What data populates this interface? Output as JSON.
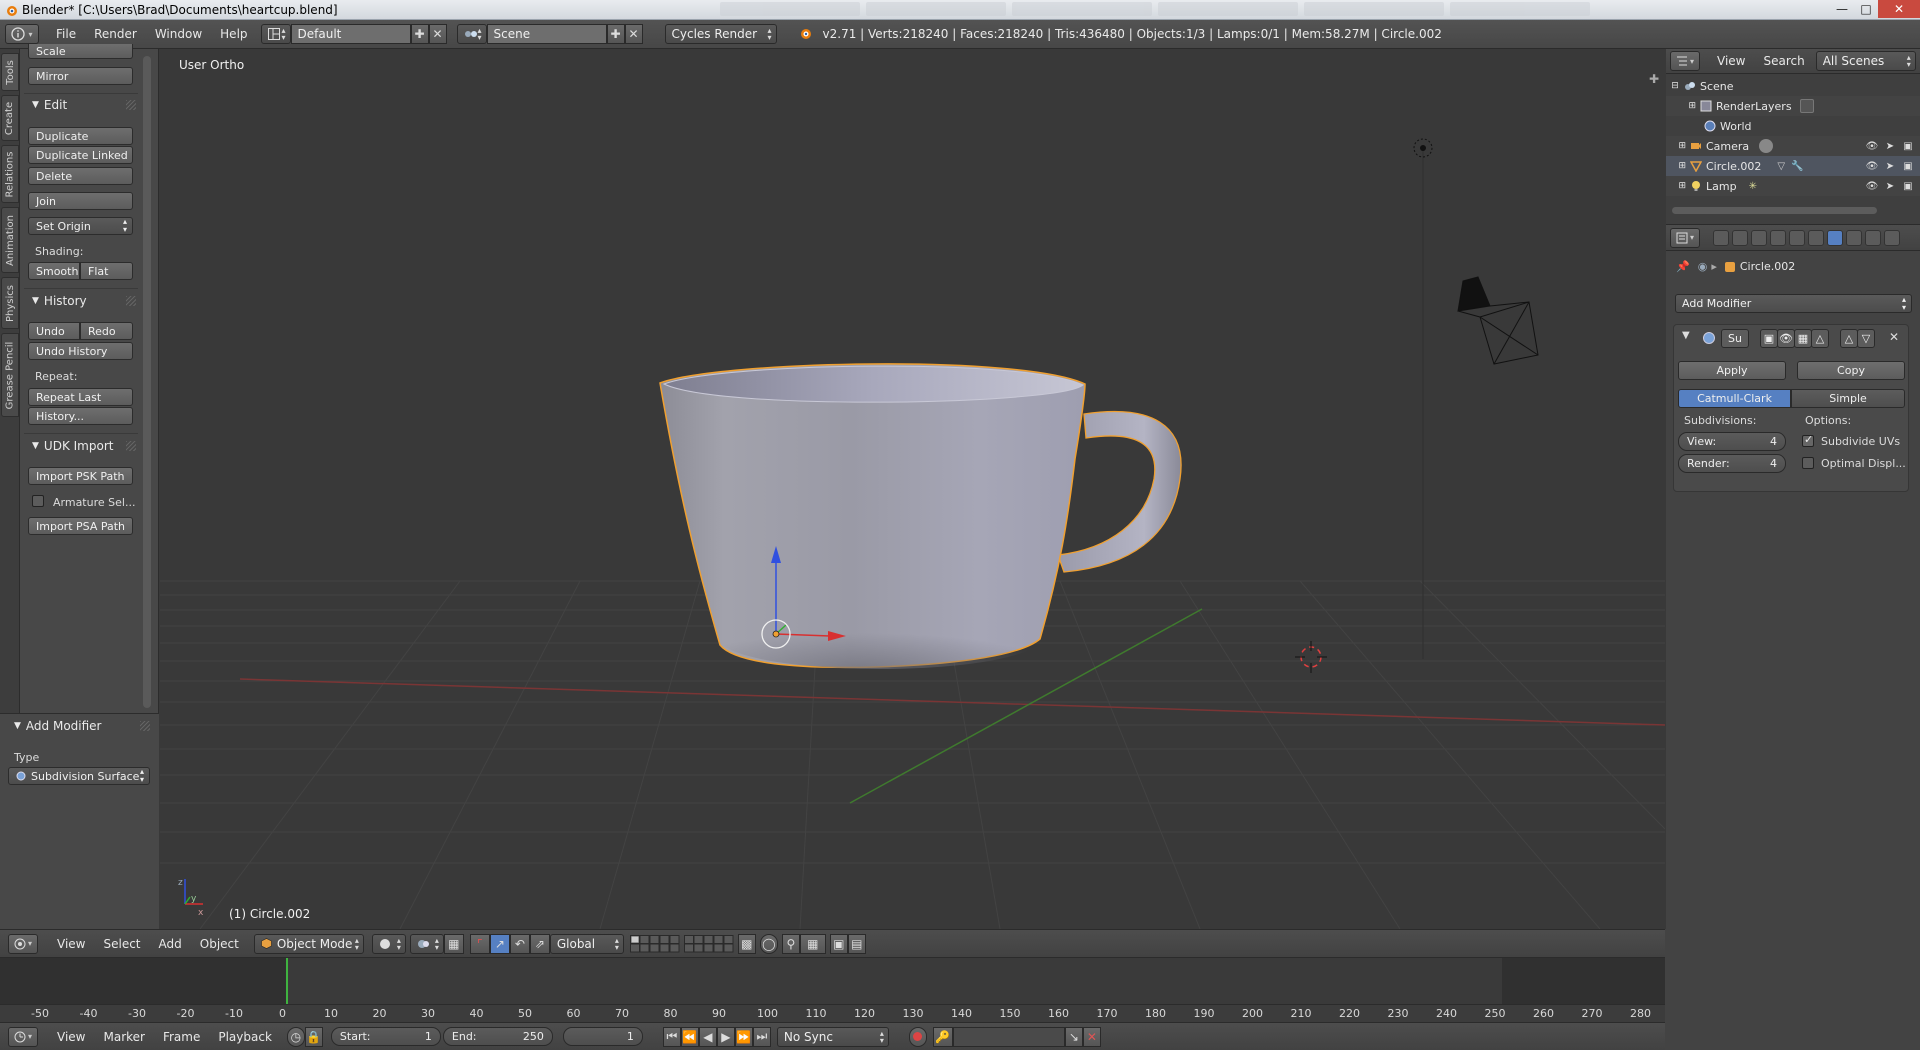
{
  "window": {
    "title": "Blender* [C:\\Users\\Brad\\Documents\\heartcup.blend]",
    "controls": [
      "minimize-icon",
      "maximize-icon",
      "close-icon"
    ]
  },
  "info_header": {
    "menus": [
      "File",
      "Render",
      "Window",
      "Help"
    ],
    "layout": "Default",
    "scene": "Scene",
    "engine": "Cycles Render",
    "stats": "v2.71 | Verts:218240 | Faces:218240 | Tris:436480 | Objects:1/3 | Lamps:0/1 | Mem:58.27M | Circle.002"
  },
  "shelf_tabs": [
    "Tools",
    "Create",
    "Relations",
    "Animation",
    "Physics",
    "Grease Pencil"
  ],
  "tools": {
    "scale_label": "Scale",
    "mirror_label": "Mirror",
    "edit_header": "Edit",
    "duplicate": "Duplicate",
    "duplicate_linked": "Duplicate Linked",
    "delete": "Delete",
    "join": "Join",
    "set_origin": "Set Origin",
    "shading_label": "Shading:",
    "smooth": "Smooth",
    "flat": "Flat",
    "history_header": "History",
    "undo": "Undo",
    "redo": "Redo",
    "undo_history": "Undo History",
    "repeat_label": "Repeat:",
    "repeat_last": "Repeat Last",
    "history_btn": "History...",
    "udk_header": "UDK Import",
    "import_psk": "Import PSK Path",
    "armature_sel": "Armature Sel...",
    "import_psa": "Import PSA Path"
  },
  "operator_panel": {
    "header": "Add Modifier",
    "type_label": "Type",
    "type_value": "Subdivision Surface"
  },
  "viewport": {
    "view_name": "User Ortho",
    "object_label": "(1) Circle.002"
  },
  "view3d_header": {
    "menus": [
      "View",
      "Select",
      "Add",
      "Object"
    ],
    "mode": "Object Mode",
    "orientation": "Global"
  },
  "outliner": {
    "menus": [
      "View",
      "Search"
    ],
    "display": "All Scenes",
    "rows": [
      {
        "label": "Scene"
      },
      {
        "label": "RenderLayers"
      },
      {
        "label": "World"
      },
      {
        "label": "Camera"
      },
      {
        "label": "Circle.002"
      },
      {
        "label": "Lamp"
      }
    ]
  },
  "properties": {
    "object_name": "Circle.002",
    "add_modifier": "Add Modifier",
    "modifier_name": "Su",
    "apply": "Apply",
    "copy": "Copy",
    "catmull": "Catmull-Clark",
    "simple": "Simple",
    "subdivisions_label": "Subdivisions:",
    "options_label": "Options:",
    "view_label": "View:",
    "view_value": "4",
    "render_label": "Render:",
    "render_value": "4",
    "subdivide_uvs": "Subdivide UVs",
    "subdivide_uvs_checked": true,
    "optimal_display": "Optimal Displ...",
    "optimal_display_checked": false
  },
  "timeline": {
    "ticks": [
      "-50",
      "-40",
      "-30",
      "-20",
      "-10",
      "0",
      "10",
      "20",
      "30",
      "40",
      "50",
      "60",
      "70",
      "80",
      "90",
      "100",
      "110",
      "120",
      "130",
      "140",
      "150",
      "160",
      "170",
      "180",
      "190",
      "200",
      "210",
      "220",
      "230",
      "240",
      "250",
      "260",
      "270",
      "280"
    ],
    "menus": [
      "View",
      "Marker",
      "Frame",
      "Playback"
    ],
    "start_label": "Start:",
    "start_value": "1",
    "end_label": "End:",
    "end_value": "250",
    "current_frame": "1",
    "sync": "No Sync"
  },
  "colors": {
    "selection_outline": "#f0a030",
    "active_tab": "#5680c2",
    "x_axis": "#d83030",
    "y_axis": "#30b030",
    "z_axis": "#3050e0"
  }
}
